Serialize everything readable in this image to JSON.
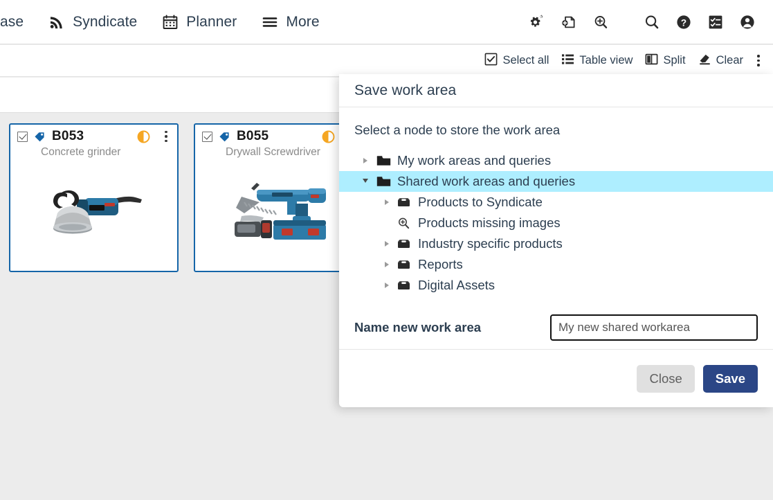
{
  "topnav": {
    "items": [
      {
        "label": "ase",
        "icon": "truncated-text",
        "truncated": true
      },
      {
        "label": "Syndicate",
        "icon": "rss-icon"
      },
      {
        "label": "Planner",
        "icon": "calendar-icon"
      },
      {
        "label": "More",
        "icon": "hamburger-icon"
      }
    ],
    "tools": [
      {
        "name": "settings-gears-icon"
      },
      {
        "name": "new-document-icon"
      },
      {
        "name": "zoom-in-icon"
      },
      {
        "name": "search-icon"
      },
      {
        "name": "help-icon"
      },
      {
        "name": "tasks-icon"
      },
      {
        "name": "user-avatar-icon"
      }
    ]
  },
  "toolbar": {
    "select_all": "Select all",
    "table_view": "Table view",
    "split": "Split",
    "clear": "Clear",
    "overflow": "more-options"
  },
  "cards": [
    {
      "id": "B053",
      "name": "Concrete grinder",
      "checked": true,
      "completeness": "half",
      "completeness_color": "#f5a623",
      "tag_color": "#1565a8",
      "image": "bosch-concrete-grinder"
    },
    {
      "id": "B055",
      "name": "Drywall Screwdriver",
      "checked": true,
      "completeness": "half",
      "completeness_color": "#f5a623",
      "tag_color": "#1565a8",
      "image": "bosch-drywall-screwdriver"
    }
  ],
  "dialog": {
    "title": "Save work area",
    "prompt": "Select a node to store the work area",
    "tree": [
      {
        "label": "My work areas and queries",
        "level": 1,
        "icon": "folder-icon",
        "state": "collapsed",
        "selected": false
      },
      {
        "label": "Shared work areas and queries",
        "level": 1,
        "icon": "folder-icon",
        "state": "expanded",
        "selected": true
      },
      {
        "label": "Products to Syndicate",
        "level": 2,
        "icon": "folder-open-icon",
        "state": "collapsed",
        "selected": false
      },
      {
        "label": "Products missing images",
        "level": 2,
        "icon": "query-search-icon",
        "state": "leaf",
        "selected": false
      },
      {
        "label": "Industry specific products",
        "level": 2,
        "icon": "folder-open-icon",
        "state": "collapsed",
        "selected": false
      },
      {
        "label": "Reports",
        "level": 2,
        "icon": "folder-open-icon",
        "state": "collapsed",
        "selected": false
      },
      {
        "label": "Digital Assets",
        "level": 2,
        "icon": "folder-open-icon",
        "state": "collapsed",
        "selected": false
      }
    ],
    "name_label": "Name new work area",
    "name_value": "My new shared workarea",
    "name_placeholder": "My new shared workarea",
    "close_label": "Close",
    "save_label": "Save",
    "selection_color": "#aeeeff",
    "save_button_color": "#2b4686"
  }
}
